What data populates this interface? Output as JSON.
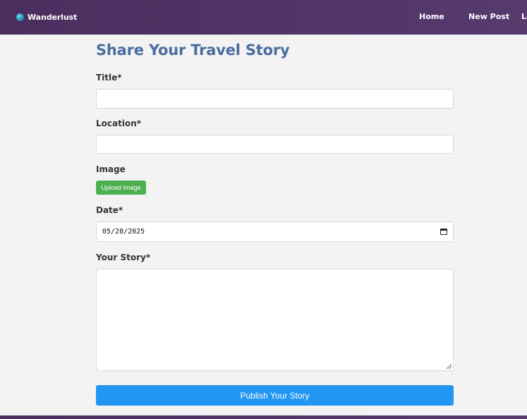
{
  "navbar": {
    "brand": "Wanderlust",
    "links": [
      "Home",
      "New Post",
      "Login"
    ]
  },
  "form": {
    "heading": "Share Your Travel Story",
    "title_label": "Title*",
    "title_value": "",
    "location_label": "Location*",
    "location_value": "",
    "image_label": "Image",
    "upload_button": "Upload Image",
    "date_label": "Date*",
    "date_value": "05/28/2025",
    "story_label": "Your Story*",
    "story_value": "",
    "publish_button": "Publish Your Story"
  },
  "colors": {
    "navbar": "#4a2e5e",
    "heading": "#4a6d9f",
    "upload_button": "#4caf50",
    "publish_button": "#2196f3"
  }
}
